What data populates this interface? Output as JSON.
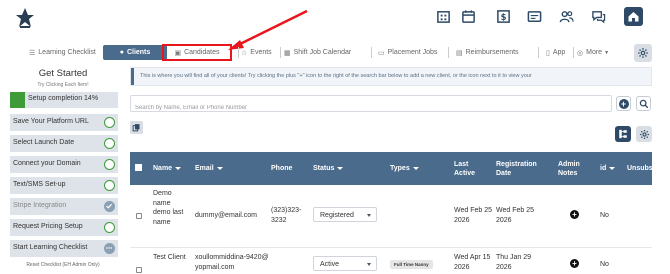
{
  "topbar": {
    "icons": [
      "building-icon",
      "calendar-icon",
      "money-icon",
      "id-card-icon",
      "users-icon",
      "chat-icon",
      "home-icon"
    ]
  },
  "tabs": [
    {
      "label": "Learning Checklist",
      "icon": "sliders-icon"
    },
    {
      "label": "Clients",
      "icon": "person-icon",
      "active": true
    },
    {
      "label": "Candidates",
      "icon": "briefcase-icon"
    },
    {
      "label": "Events",
      "icon": "star-icon"
    },
    {
      "label": "Shift Job Calendar",
      "icon": "calendar-icon"
    },
    {
      "label": "Placement Jobs",
      "icon": "monitor-icon"
    },
    {
      "label": "Reimbursements",
      "icon": "receipt-icon"
    },
    {
      "label": "App",
      "icon": "phone-icon"
    },
    {
      "label": "More",
      "icon": "globe-icon"
    }
  ],
  "sidebar": {
    "title": "Get Started",
    "subtitle": "Try Clicking Each Item!",
    "progress": {
      "label": "Setup completion 14%",
      "percent": 14
    },
    "items": [
      {
        "label": "Save Your Platform URL",
        "done": false
      },
      {
        "label": "Select Launch Date",
        "done": false
      },
      {
        "label": "Connect your Domain",
        "done": false
      },
      {
        "label": "Text/SMS Set-up",
        "done": false
      },
      {
        "label": "Stripe Integration",
        "done": true
      },
      {
        "label": "Request Pricing Setup",
        "done": false
      },
      {
        "label": "Start Learning Checklist",
        "done": true
      }
    ],
    "footer": "Reset Checklist (EH Admin Only)"
  },
  "main": {
    "info": "This is where you will find all of your clients! Try clicking the plus \"+\" icon to the right of the search bar below to add a new client, or the icon next to it to view your",
    "search_placeholder": "Search by Name, Email or Phone Number"
  },
  "table": {
    "headers": {
      "name": "Name",
      "email": "Email",
      "phone": "Phone",
      "status": "Status",
      "types": "Types",
      "last_active": "Last Active",
      "registration_date": "Registration Date",
      "admin_notes": "Admin Notes",
      "id": "id",
      "unsubs": "Unsubs"
    },
    "rows": [
      {
        "name": "Demo name demo last name",
        "email": "dummy@email.com",
        "phone": "(323)323-3232",
        "status": "Registered",
        "types": "",
        "last_active": "Wed Feb 25 2026",
        "registration_date": "Wed Feb 25 2026",
        "admin_notes": "+",
        "id": "No"
      },
      {
        "name": "Test Client",
        "email": "xoullommiddina-9420@yopmail.com",
        "phone": "",
        "status": "Active",
        "types": "Full Time Nanny",
        "last_active": "Wed Apr 15 2026",
        "registration_date": "Thu Jan 29 2026",
        "admin_notes": "+",
        "id": "No"
      }
    ]
  },
  "colors": {
    "primary": "#4a6b8c",
    "dark": "#2f4a66",
    "success": "#3d9b3a",
    "annotation": "#e8161b"
  }
}
